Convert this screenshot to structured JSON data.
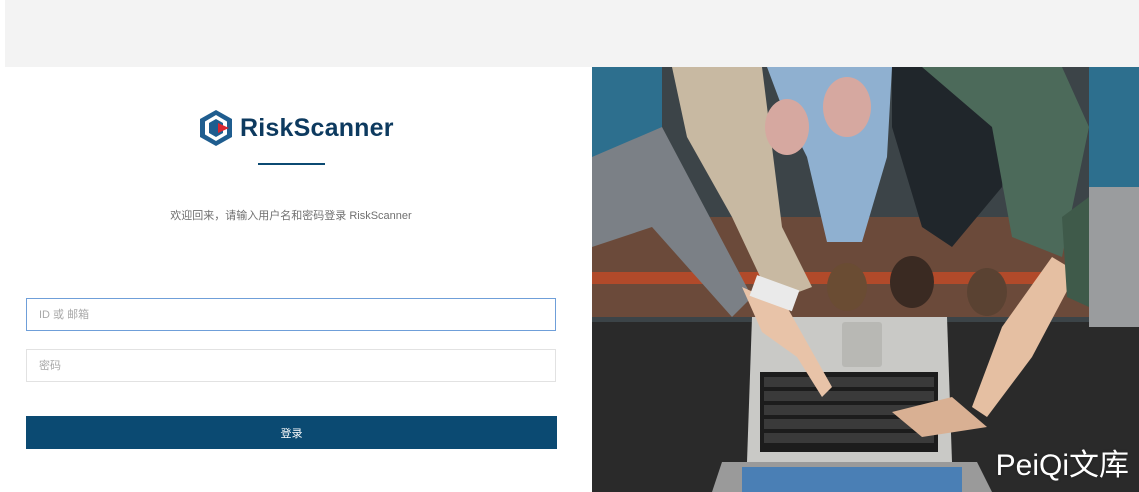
{
  "logo": {
    "brand_text": "RiskScanner"
  },
  "login": {
    "welcome_text": "欢迎回来，请输入用户名和密码登录 RiskScanner",
    "username_placeholder": "ID 或 邮箱",
    "password_placeholder": "密码",
    "submit_label": "登录"
  },
  "watermark": {
    "text": "PeiQi文库"
  },
  "colors": {
    "brand_navy": "#0b4a72",
    "logo_red": "#d9252f",
    "logo_blue": "#1f5d8f",
    "topbar_gray": "#f3f3f3"
  }
}
